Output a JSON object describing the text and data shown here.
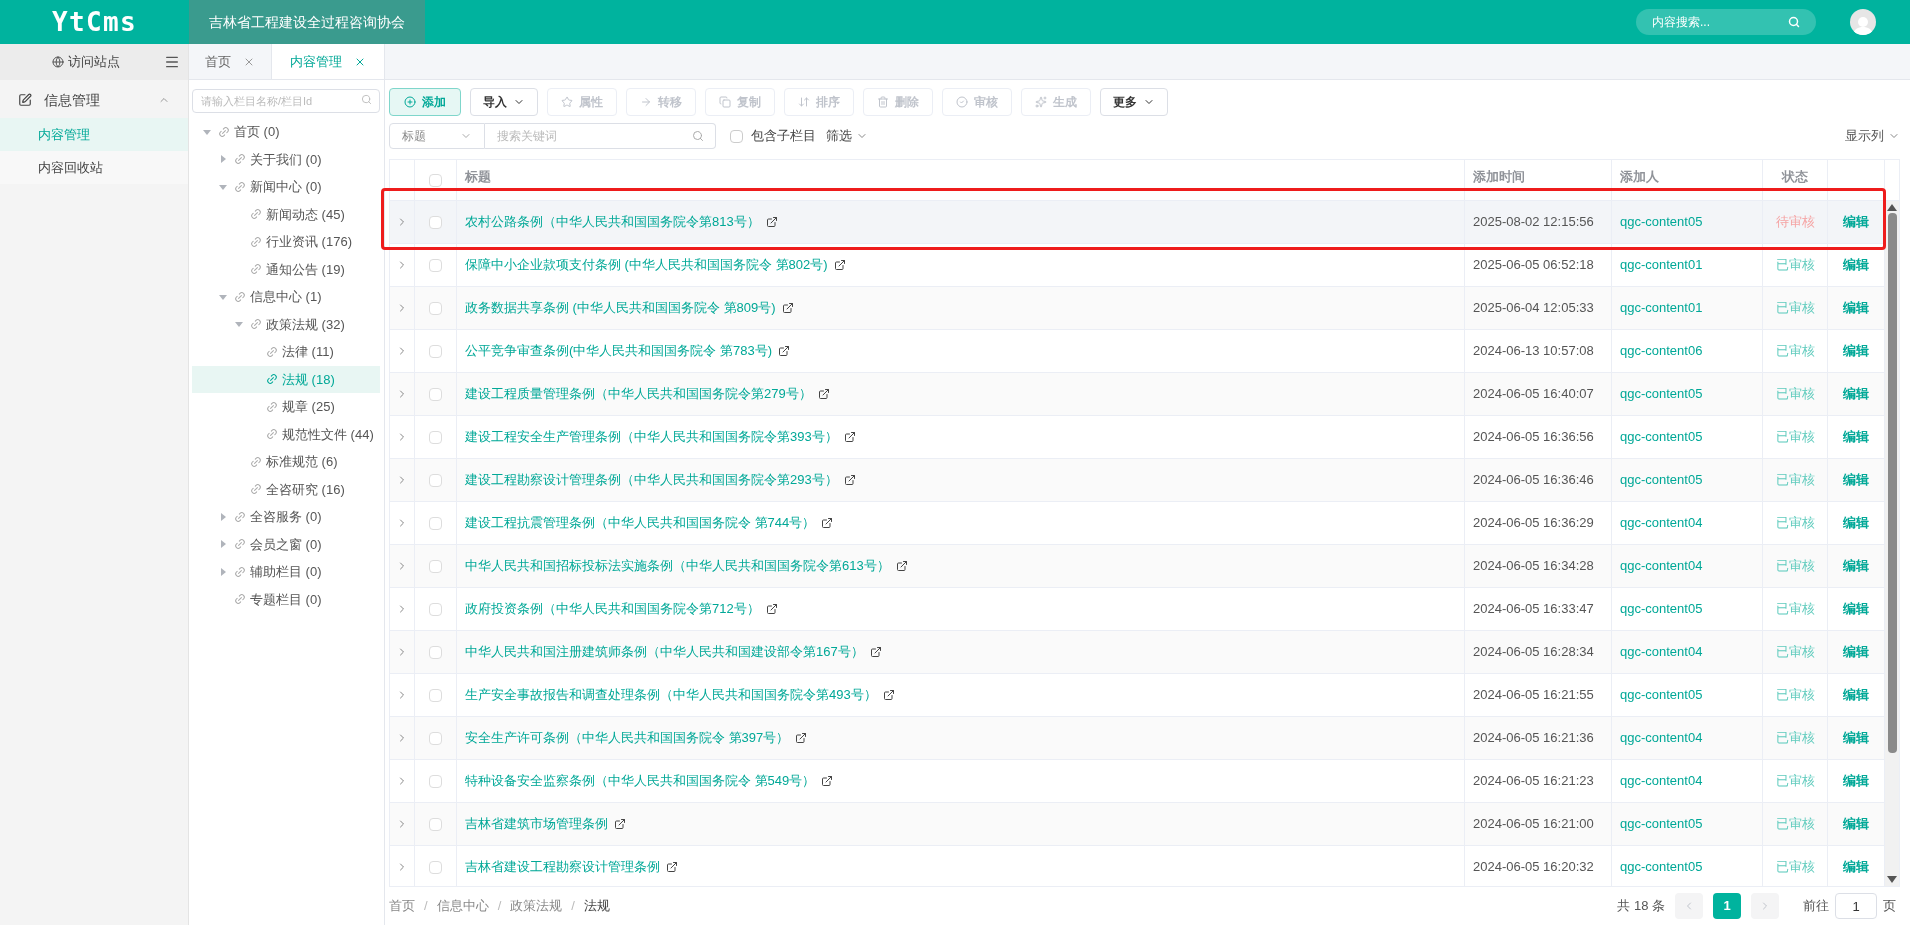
{
  "header": {
    "logo": "YtCms",
    "site": "吉林省工程建设全过程咨询协会",
    "search": {
      "placeholder": "内容搜索..."
    }
  },
  "sidebar": {
    "visit": "访问站点",
    "groups": [
      {
        "label": "信息管理",
        "expanded": true,
        "items": [
          {
            "label": "内容管理",
            "selected": true
          },
          {
            "label": "内容回收站",
            "selected": false
          }
        ]
      }
    ]
  },
  "tabs": [
    {
      "label": "首页",
      "selected": false
    },
    {
      "label": "内容管理",
      "selected": true
    }
  ],
  "tree": {
    "search": {
      "placeholder": "请输入栏目名称/栏目Id"
    },
    "nodes": [
      {
        "label": "首页 (0)",
        "expanded": true,
        "selected": false,
        "children": [
          {
            "label": "关于我们 (0)",
            "expanded": false,
            "selected": false
          },
          {
            "label": "新闻中心 (0)",
            "expanded": true,
            "selected": false,
            "children": [
              {
                "label": "新闻动态 (45)",
                "selected": false
              },
              {
                "label": "行业资讯 (176)",
                "selected": false
              },
              {
                "label": "通知公告 (19)",
                "selected": false
              }
            ]
          },
          {
            "label": "信息中心 (1)",
            "expanded": true,
            "selected": false,
            "children": [
              {
                "label": "政策法规 (32)",
                "expanded": true,
                "selected": false,
                "children": [
                  {
                    "label": "法律 (11)",
                    "selected": false
                  },
                  {
                    "label": "法规 (18)",
                    "selected": true
                  },
                  {
                    "label": "规章 (25)",
                    "selected": false
                  },
                  {
                    "label": "规范性文件 (44)",
                    "selected": false
                  }
                ]
              },
              {
                "label": "标准规范 (6)",
                "selected": false
              },
              {
                "label": "全咨研究 (16)",
                "selected": false
              }
            ]
          },
          {
            "label": "全咨服务 (0)",
            "expanded": false,
            "selected": false
          },
          {
            "label": "会员之窗 (0)",
            "expanded": false,
            "selected": false
          },
          {
            "label": "辅助栏目 (0)",
            "expanded": false,
            "selected": false
          },
          {
            "label": "专题栏目 (0)",
            "selected": false
          }
        ]
      }
    ]
  },
  "toolbar": [
    {
      "label": "添加",
      "kind": "primary",
      "disabled": false
    },
    {
      "label": "导入",
      "kind": "dropdown",
      "disabled": false
    },
    {
      "label": "属性",
      "kind": "plain",
      "disabled": true
    },
    {
      "label": "转移",
      "kind": "plain",
      "disabled": true
    },
    {
      "label": "复制",
      "kind": "plain",
      "disabled": true
    },
    {
      "label": "排序",
      "kind": "plain",
      "disabled": true
    },
    {
      "label": "删除",
      "kind": "plain",
      "disabled": true
    },
    {
      "label": "审核",
      "kind": "plain",
      "disabled": true
    },
    {
      "label": "生成",
      "kind": "plain",
      "disabled": true
    },
    {
      "label": "更多",
      "kind": "dropdown",
      "disabled": false
    }
  ],
  "filter": {
    "field": "标题",
    "search_placeholder": "搜索关键词",
    "include_children": {
      "label": "包含子栏目",
      "checked": false
    },
    "screen": "筛选",
    "columns": "显示列"
  },
  "table": {
    "columns": [
      "标题",
      "添加时间",
      "添加人",
      "状态"
    ],
    "all_checked": false,
    "rows": [
      {
        "title": "农村公路条例（中华人民共和国国务院令第813号）",
        "time": "2025-08-02 12:15:56",
        "author": "qgc-content05",
        "status": "待审核",
        "reviewed": false,
        "action": "编辑",
        "highlighted": true
      },
      {
        "title": "保障中小企业款项支付条例 (中华人民共和国国务院令 第802号)",
        "time": "2025-06-05 06:52:18",
        "author": "qgc-content01",
        "status": "已审核",
        "reviewed": true,
        "action": "编辑",
        "highlighted": false
      },
      {
        "title": "政务数据共享条例 (中华人民共和国国务院令 第809号)",
        "time": "2025-06-04 12:05:33",
        "author": "qgc-content01",
        "status": "已审核",
        "reviewed": true,
        "action": "编辑",
        "highlighted": false
      },
      {
        "title": "公平竞争审查条例(中华人民共和国国务院令 第783号)",
        "time": "2024-06-13 10:57:08",
        "author": "qgc-content06",
        "status": "已审核",
        "reviewed": true,
        "action": "编辑",
        "highlighted": false
      },
      {
        "title": "建设工程质量管理条例（中华人民共和国国务院令第279号）",
        "time": "2024-06-05 16:40:07",
        "author": "qgc-content05",
        "status": "已审核",
        "reviewed": true,
        "action": "编辑",
        "highlighted": false
      },
      {
        "title": "建设工程安全生产管理条例（中华人民共和国国务院令第393号）",
        "time": "2024-06-05 16:36:56",
        "author": "qgc-content05",
        "status": "已审核",
        "reviewed": true,
        "action": "编辑",
        "highlighted": false
      },
      {
        "title": "建设工程勘察设计管理条例（中华人民共和国国务院令第293号）",
        "time": "2024-06-05 16:36:46",
        "author": "qgc-content05",
        "status": "已审核",
        "reviewed": true,
        "action": "编辑",
        "highlighted": false
      },
      {
        "title": "建设工程抗震管理条例（中华人民共和国国务院令 第744号）",
        "time": "2024-06-05 16:36:29",
        "author": "qgc-content04",
        "status": "已审核",
        "reviewed": true,
        "action": "编辑",
        "highlighted": false
      },
      {
        "title": "中华人民共和国招标投标法实施条例（中华人民共和国国务院令第613号）",
        "time": "2024-06-05 16:34:28",
        "author": "qgc-content04",
        "status": "已审核",
        "reviewed": true,
        "action": "编辑",
        "highlighted": false
      },
      {
        "title": "政府投资条例（中华人民共和国国务院令第712号）",
        "time": "2024-06-05 16:33:47",
        "author": "qgc-content05",
        "status": "已审核",
        "reviewed": true,
        "action": "编辑",
        "highlighted": false
      },
      {
        "title": "中华人民共和国注册建筑师条例（中华人民共和国建设部令第167号）",
        "time": "2024-06-05 16:28:34",
        "author": "qgc-content04",
        "status": "已审核",
        "reviewed": true,
        "action": "编辑",
        "highlighted": false
      },
      {
        "title": "生产安全事故报告和调查处理条例（中华人民共和国国务院令第493号）",
        "time": "2024-06-05 16:21:55",
        "author": "qgc-content05",
        "status": "已审核",
        "reviewed": true,
        "action": "编辑",
        "highlighted": false
      },
      {
        "title": "安全生产许可条例（中华人民共和国国务院令 第397号）",
        "time": "2024-06-05 16:21:36",
        "author": "qgc-content04",
        "status": "已审核",
        "reviewed": true,
        "action": "编辑",
        "highlighted": false
      },
      {
        "title": "特种设备安全监察条例（中华人民共和国国务院令 第549号）",
        "time": "2024-06-05 16:21:23",
        "author": "qgc-content04",
        "status": "已审核",
        "reviewed": true,
        "action": "编辑",
        "highlighted": false
      },
      {
        "title": "吉林省建筑市场管理条例",
        "time": "2024-06-05 16:21:00",
        "author": "qgc-content05",
        "status": "已审核",
        "reviewed": true,
        "action": "编辑",
        "highlighted": false
      },
      {
        "title": "吉林省建设工程勘察设计管理条例",
        "time": "2024-06-05 16:20:32",
        "author": "qgc-content05",
        "status": "已审核",
        "reviewed": true,
        "action": "编辑",
        "highlighted": false
      }
    ]
  },
  "breadcrumb": {
    "separator": "/",
    "items": [
      "首页",
      "信息中心",
      "政策法规",
      "法规"
    ]
  },
  "pagination": {
    "total": "共 18 条",
    "pages": [
      {
        "label": "1",
        "selected": true
      }
    ],
    "goto": "前往",
    "page_input": "1",
    "page_unit": "页"
  }
}
